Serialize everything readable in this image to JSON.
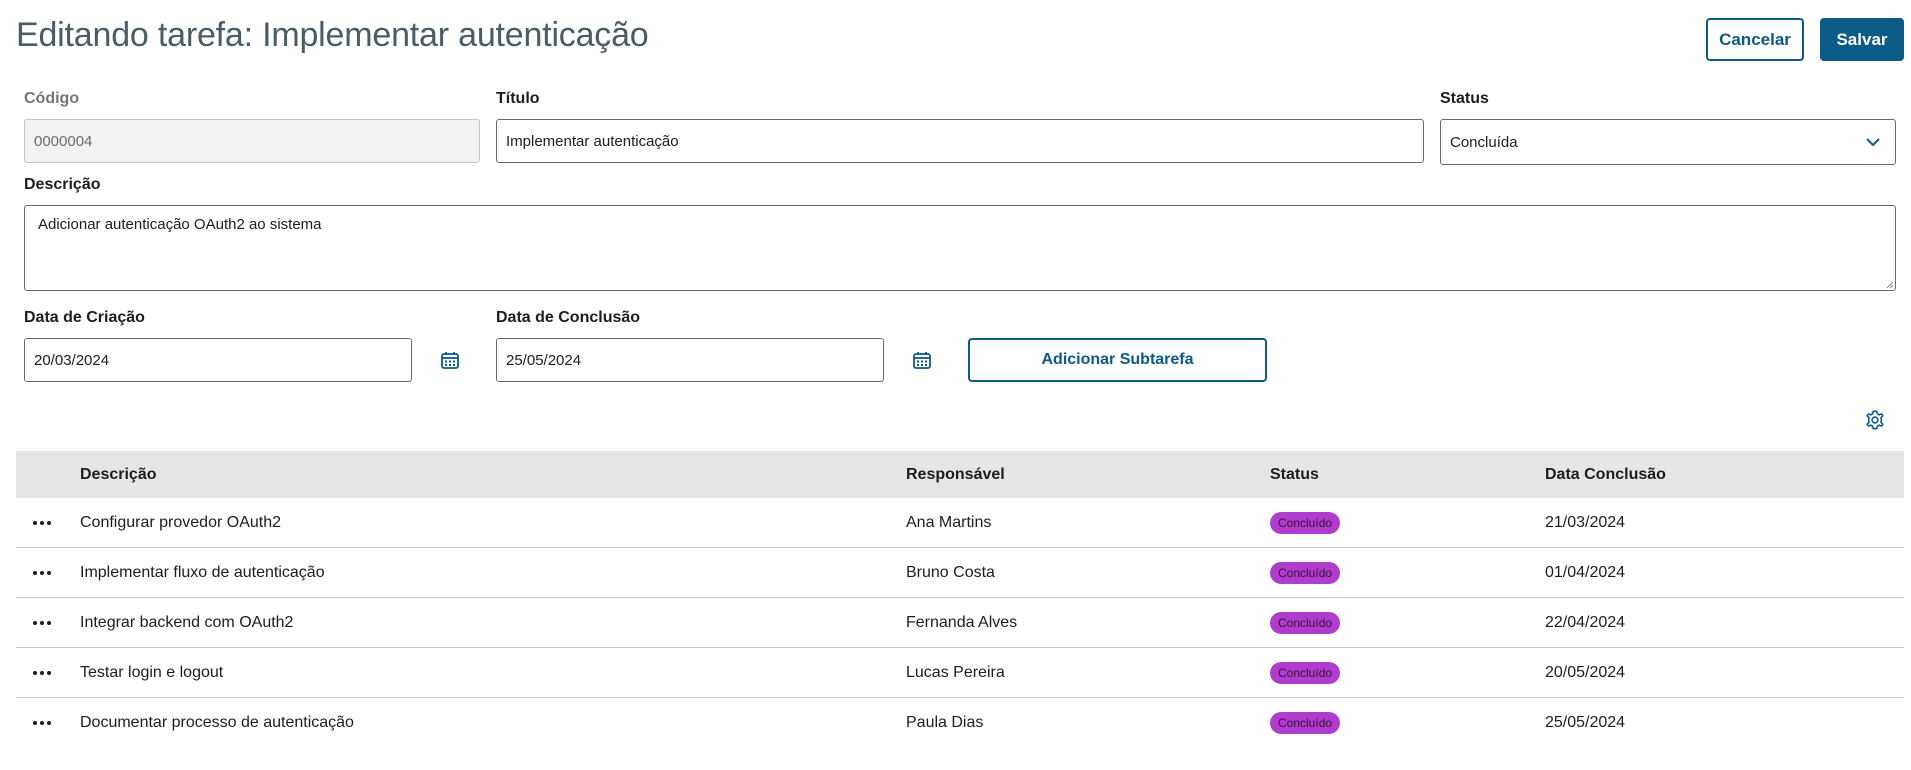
{
  "header": {
    "title": "Editando tarefa: Implementar autenticação",
    "cancel_label": "Cancelar",
    "save_label": "Salvar"
  },
  "form": {
    "codigo": {
      "label": "Código",
      "value": "0000004"
    },
    "titulo": {
      "label": "Título",
      "value": "Implementar autenticação"
    },
    "status": {
      "label": "Status",
      "value": "Concluída"
    },
    "descricao": {
      "label": "Descrição",
      "value": "Adicionar autenticação OAuth2 ao sistema"
    },
    "data_criacao": {
      "label": "Data de Criação",
      "value": "20/03/2024"
    },
    "data_conclusao": {
      "label": "Data de Conclusão",
      "value": "25/05/2024"
    },
    "add_subtask_label": "Adicionar Subtarefa"
  },
  "table": {
    "columns": [
      "Descrição",
      "Responsável",
      "Status",
      "Data Conclusão"
    ],
    "rows": [
      {
        "descricao": "Configurar provedor OAuth2",
        "responsavel": "Ana Martins",
        "status": "Concluído",
        "data": "21/03/2024"
      },
      {
        "descricao": "Implementar fluxo de autenticação",
        "responsavel": "Bruno Costa",
        "status": "Concluído",
        "data": "01/04/2024"
      },
      {
        "descricao": "Integrar backend com OAuth2",
        "responsavel": "Fernanda Alves",
        "status": "Concluído",
        "data": "22/04/2024"
      },
      {
        "descricao": "Testar login e logout",
        "responsavel": "Lucas Pereira",
        "status": "Concluído",
        "data": "20/05/2024"
      },
      {
        "descricao": "Documentar processo de autenticação",
        "responsavel": "Paula Dias",
        "status": "Concluído",
        "data": "25/05/2024"
      }
    ]
  },
  "icons": {
    "row_actions": "more-horizontal-icon",
    "calendar": "calendar-icon",
    "settings": "gear-icon",
    "dropdown": "chevron-down-icon"
  },
  "colors": {
    "primary": "#0c5a86",
    "badge": "#b03ccb",
    "header_bg": "#e6e6e6"
  }
}
